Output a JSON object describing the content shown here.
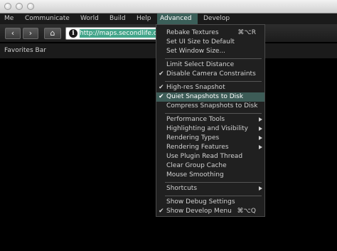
{
  "menubar": {
    "items": [
      "Me",
      "Communicate",
      "World",
      "Build",
      "Help",
      "Advanced",
      "Develop"
    ],
    "active": "Advanced"
  },
  "toolbar": {
    "back_icon": "‹",
    "forward_icon": "›",
    "home_icon": "⌂",
    "info_icon": "i",
    "url": "http://maps.secondlife.co"
  },
  "favorites": {
    "label": "Favorites Bar"
  },
  "advanced_menu": {
    "items": [
      {
        "label": "Rebake Textures",
        "shortcut": "⌘⌥R"
      },
      {
        "label": "Set UI Size to Default"
      },
      {
        "label": "Set Window Size..."
      },
      {
        "label": "Limit Select Distance"
      },
      {
        "label": "Disable Camera Constraints",
        "checked": true
      },
      {
        "label": "High-res Snapshot",
        "checked": true
      },
      {
        "label": "Quiet Snapshots to Disk",
        "checked": true,
        "highlighted": true
      },
      {
        "label": "Compress Snapshots to Disk"
      },
      {
        "label": "Performance Tools",
        "submenu": true
      },
      {
        "label": "Highlighting and Visibility",
        "submenu": true
      },
      {
        "label": "Rendering Types",
        "submenu": true
      },
      {
        "label": "Rendering Features",
        "submenu": true
      },
      {
        "label": "Use Plugin Read Thread"
      },
      {
        "label": "Clear Group Cache"
      },
      {
        "label": "Mouse Smoothing"
      },
      {
        "label": "Shortcuts",
        "submenu": true
      },
      {
        "label": "Show Debug Settings"
      },
      {
        "label": "Show Develop Menu",
        "checked": true,
        "shortcut": "⌘⌥Q"
      }
    ],
    "checkmark": "✔"
  },
  "colors": {
    "highlight": "#3d5c57",
    "active_menu": "#3b5f59",
    "url_selection": "#43a58a"
  }
}
